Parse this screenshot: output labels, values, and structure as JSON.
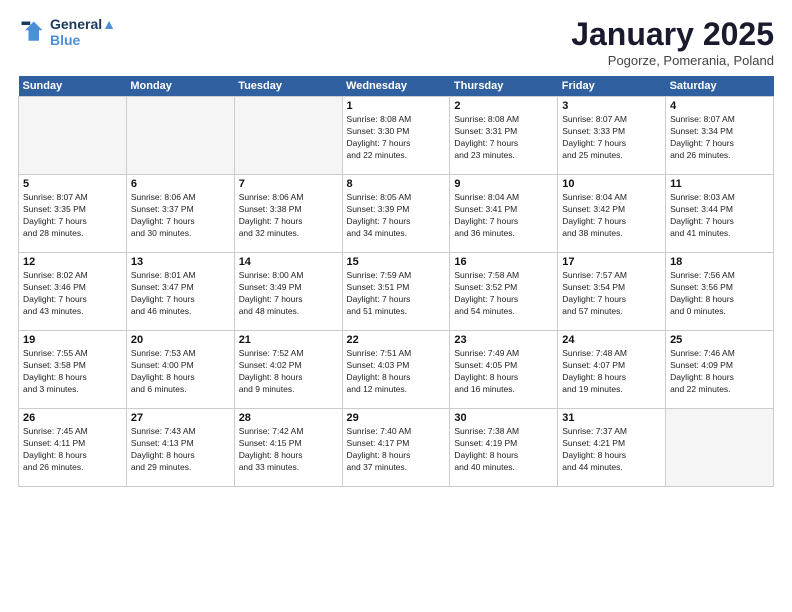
{
  "logo": {
    "line1": "General",
    "line2": "Blue"
  },
  "title": "January 2025",
  "location": "Pogorze, Pomerania, Poland",
  "days_of_week": [
    "Sunday",
    "Monday",
    "Tuesday",
    "Wednesday",
    "Thursday",
    "Friday",
    "Saturday"
  ],
  "weeks": [
    [
      {
        "day": "",
        "info": ""
      },
      {
        "day": "",
        "info": ""
      },
      {
        "day": "",
        "info": ""
      },
      {
        "day": "1",
        "info": "Sunrise: 8:08 AM\nSunset: 3:30 PM\nDaylight: 7 hours\nand 22 minutes."
      },
      {
        "day": "2",
        "info": "Sunrise: 8:08 AM\nSunset: 3:31 PM\nDaylight: 7 hours\nand 23 minutes."
      },
      {
        "day": "3",
        "info": "Sunrise: 8:07 AM\nSunset: 3:33 PM\nDaylight: 7 hours\nand 25 minutes."
      },
      {
        "day": "4",
        "info": "Sunrise: 8:07 AM\nSunset: 3:34 PM\nDaylight: 7 hours\nand 26 minutes."
      }
    ],
    [
      {
        "day": "5",
        "info": "Sunrise: 8:07 AM\nSunset: 3:35 PM\nDaylight: 7 hours\nand 28 minutes."
      },
      {
        "day": "6",
        "info": "Sunrise: 8:06 AM\nSunset: 3:37 PM\nDaylight: 7 hours\nand 30 minutes."
      },
      {
        "day": "7",
        "info": "Sunrise: 8:06 AM\nSunset: 3:38 PM\nDaylight: 7 hours\nand 32 minutes."
      },
      {
        "day": "8",
        "info": "Sunrise: 8:05 AM\nSunset: 3:39 PM\nDaylight: 7 hours\nand 34 minutes."
      },
      {
        "day": "9",
        "info": "Sunrise: 8:04 AM\nSunset: 3:41 PM\nDaylight: 7 hours\nand 36 minutes."
      },
      {
        "day": "10",
        "info": "Sunrise: 8:04 AM\nSunset: 3:42 PM\nDaylight: 7 hours\nand 38 minutes."
      },
      {
        "day": "11",
        "info": "Sunrise: 8:03 AM\nSunset: 3:44 PM\nDaylight: 7 hours\nand 41 minutes."
      }
    ],
    [
      {
        "day": "12",
        "info": "Sunrise: 8:02 AM\nSunset: 3:46 PM\nDaylight: 7 hours\nand 43 minutes."
      },
      {
        "day": "13",
        "info": "Sunrise: 8:01 AM\nSunset: 3:47 PM\nDaylight: 7 hours\nand 46 minutes."
      },
      {
        "day": "14",
        "info": "Sunrise: 8:00 AM\nSunset: 3:49 PM\nDaylight: 7 hours\nand 48 minutes."
      },
      {
        "day": "15",
        "info": "Sunrise: 7:59 AM\nSunset: 3:51 PM\nDaylight: 7 hours\nand 51 minutes."
      },
      {
        "day": "16",
        "info": "Sunrise: 7:58 AM\nSunset: 3:52 PM\nDaylight: 7 hours\nand 54 minutes."
      },
      {
        "day": "17",
        "info": "Sunrise: 7:57 AM\nSunset: 3:54 PM\nDaylight: 7 hours\nand 57 minutes."
      },
      {
        "day": "18",
        "info": "Sunrise: 7:56 AM\nSunset: 3:56 PM\nDaylight: 8 hours\nand 0 minutes."
      }
    ],
    [
      {
        "day": "19",
        "info": "Sunrise: 7:55 AM\nSunset: 3:58 PM\nDaylight: 8 hours\nand 3 minutes."
      },
      {
        "day": "20",
        "info": "Sunrise: 7:53 AM\nSunset: 4:00 PM\nDaylight: 8 hours\nand 6 minutes."
      },
      {
        "day": "21",
        "info": "Sunrise: 7:52 AM\nSunset: 4:02 PM\nDaylight: 8 hours\nand 9 minutes."
      },
      {
        "day": "22",
        "info": "Sunrise: 7:51 AM\nSunset: 4:03 PM\nDaylight: 8 hours\nand 12 minutes."
      },
      {
        "day": "23",
        "info": "Sunrise: 7:49 AM\nSunset: 4:05 PM\nDaylight: 8 hours\nand 16 minutes."
      },
      {
        "day": "24",
        "info": "Sunrise: 7:48 AM\nSunset: 4:07 PM\nDaylight: 8 hours\nand 19 minutes."
      },
      {
        "day": "25",
        "info": "Sunrise: 7:46 AM\nSunset: 4:09 PM\nDaylight: 8 hours\nand 22 minutes."
      }
    ],
    [
      {
        "day": "26",
        "info": "Sunrise: 7:45 AM\nSunset: 4:11 PM\nDaylight: 8 hours\nand 26 minutes."
      },
      {
        "day": "27",
        "info": "Sunrise: 7:43 AM\nSunset: 4:13 PM\nDaylight: 8 hours\nand 29 minutes."
      },
      {
        "day": "28",
        "info": "Sunrise: 7:42 AM\nSunset: 4:15 PM\nDaylight: 8 hours\nand 33 minutes."
      },
      {
        "day": "29",
        "info": "Sunrise: 7:40 AM\nSunset: 4:17 PM\nDaylight: 8 hours\nand 37 minutes."
      },
      {
        "day": "30",
        "info": "Sunrise: 7:38 AM\nSunset: 4:19 PM\nDaylight: 8 hours\nand 40 minutes."
      },
      {
        "day": "31",
        "info": "Sunrise: 7:37 AM\nSunset: 4:21 PM\nDaylight: 8 hours\nand 44 minutes."
      },
      {
        "day": "",
        "info": ""
      }
    ]
  ]
}
